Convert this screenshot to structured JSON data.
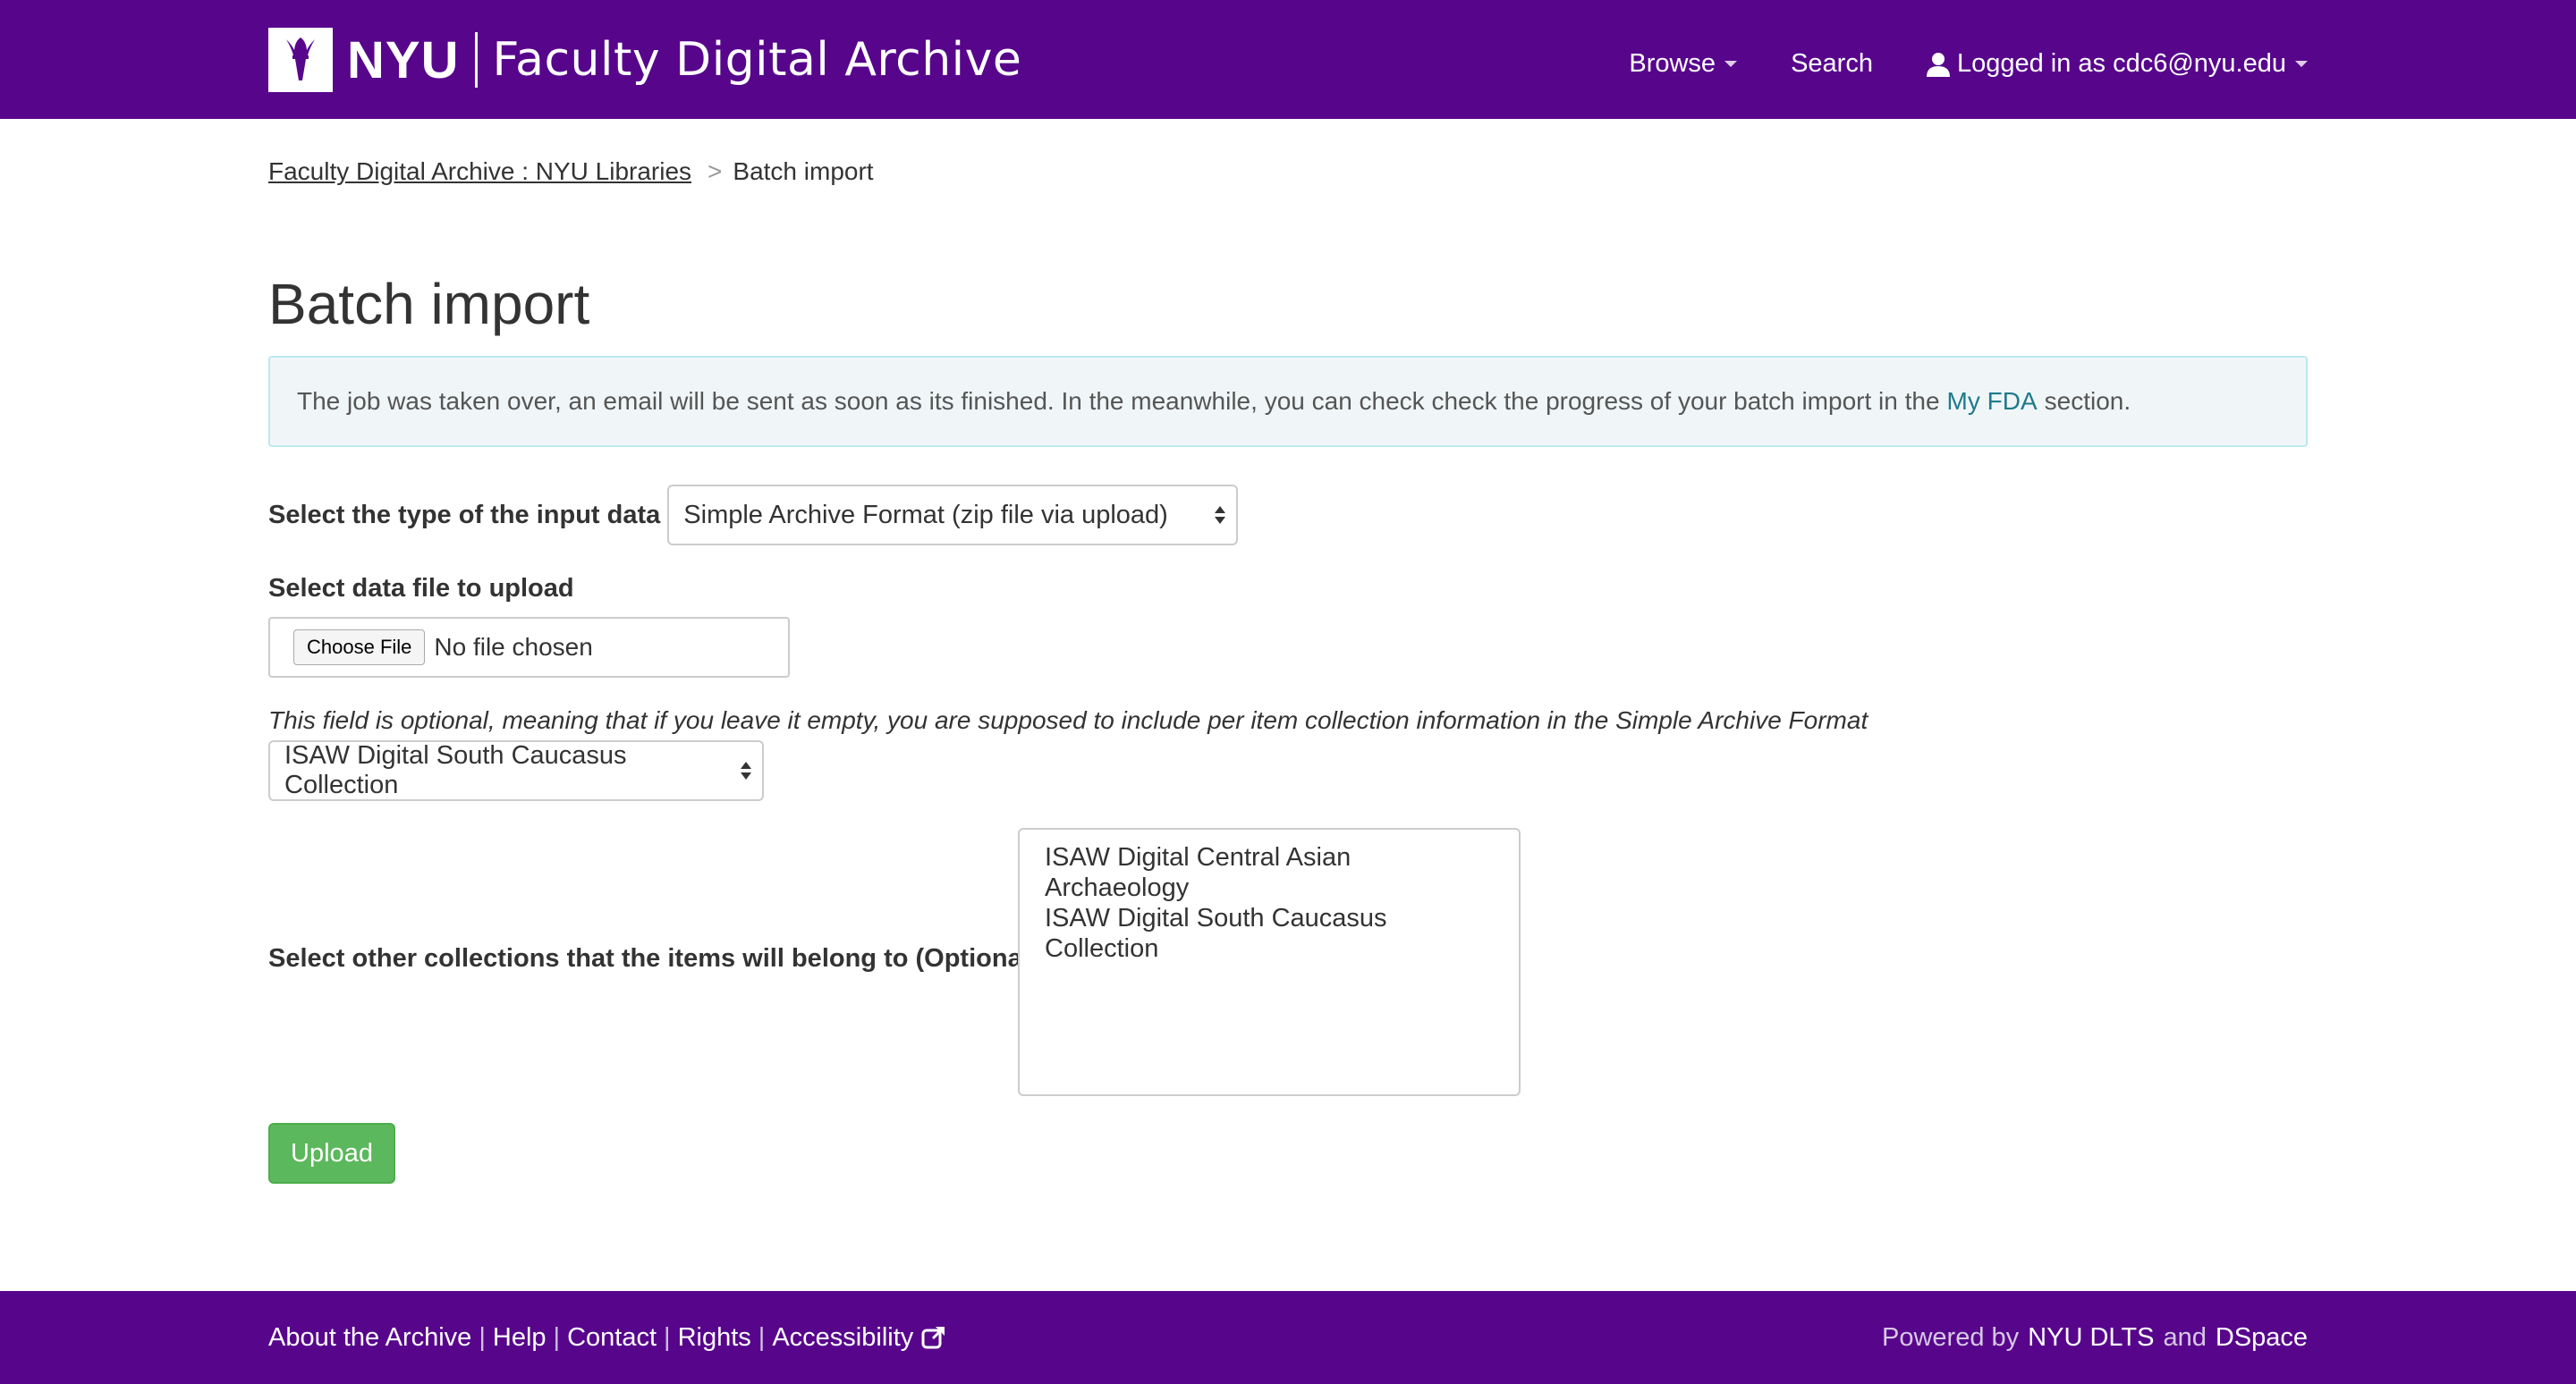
{
  "header": {
    "brand_nyu": "NYU",
    "brand_title": "Faculty Digital Archive",
    "nav": {
      "browse": "Browse",
      "search": "Search",
      "user": "Logged in as cdc6@nyu.edu"
    },
    "colors": {
      "brand_purple": "#57068c"
    }
  },
  "breadcrumb": {
    "home": "Faculty Digital Archive : NYU Libraries",
    "separator": ">",
    "current": "Batch import"
  },
  "main": {
    "title": "Batch import",
    "alert": {
      "text_before": "The job was taken over, an email will be sent as soon as its finished. In the meanwhile, you can check check the progress of your batch import in the",
      "link": "My FDA",
      "text_after": "section."
    },
    "input_type": {
      "label": "Select the type of the input data",
      "selected": "Simple Archive Format (zip file via upload)"
    },
    "upload": {
      "label": "Select data file to upload",
      "choose_button": "Choose File",
      "status": "No file chosen"
    },
    "collection": {
      "help": "This field is optional, meaning that if you leave it empty, you are supposed to include per item collection information in the Simple Archive Format",
      "selected": "ISAW Digital South Caucasus Collection"
    },
    "other_collections": {
      "label": "Select other collections that the items will belong to (Optional)",
      "options": [
        "ISAW Digital Central Asian Archaeology",
        "ISAW Digital South Caucasus Collection"
      ]
    },
    "upload_button": "Upload",
    "colors": {
      "upload_green": "#5cb85c",
      "link_teal": "#1f7a8c"
    }
  },
  "footer": {
    "links": [
      "About the Archive",
      "Help",
      "Contact",
      "Rights",
      "Accessibility"
    ],
    "separator": "|",
    "powered_prefix": "Powered by",
    "powered_link1": "NYU DLTS",
    "powered_and": "and",
    "powered_link2": "DSpace"
  }
}
